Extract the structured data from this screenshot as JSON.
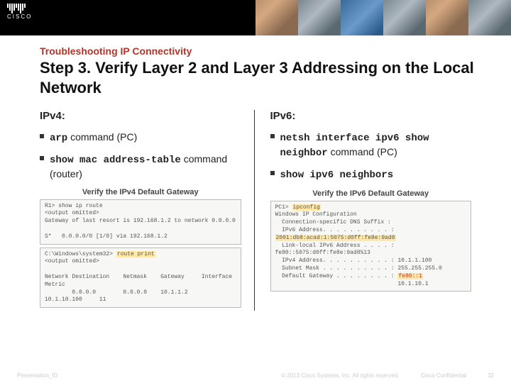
{
  "logo_text": "CISCO",
  "breadcrumb": "Troubleshooting IP Connectivity",
  "title": "Step 3. Verify Layer 2 and Layer 3 Addressing on the Local Network",
  "left": {
    "heading": "IPv4:",
    "b1_cmd": "arp",
    "b1_rest": " command (PC)",
    "b2_cmd": "show mac address-table",
    "b2_rest": " command (router)",
    "shot_title": "Verify the IPv4 Default Gateway",
    "pane1": "R1> show ip route\n<output omitted>\nGateway of last resort is 192.168.1.2 to network 0.0.0.0\n\nS*   0.0.0.0/0 [1/0] via 192.168.1.2",
    "pane2_pre": "C:\\Windows\\system32> ",
    "pane2_cmd": "route print",
    "pane2_rest": "\n<output omitted>\n\nNetwork Destination    Netmask    Gateway     Interface    Metric\n        0.0.0.0        0.0.0.0    10.1.1.2    10.1.10.100     11"
  },
  "right": {
    "heading": "IPv6:",
    "b1_cmd": "netsh interface ipv6 show neighbor",
    "b1_rest": " command (PC)",
    "b2_cmd": "show ipv6 neighbors",
    "shot_title": "Verify the IPv6 Default Gateway",
    "pane_pre": "PC1> ",
    "pane_cmd": "ipconfig",
    "pane_l1": "Windows IP Configuration",
    "pane_l2": "  Connection-specific DNS Suffix :",
    "pane_l3": "  IPv6 Address. . . . . . . . . . :",
    "pane_hl": "2001:db8:acad:1:5075:d0ff:fe8e:9ad8",
    "pane_l4_a": "  Link-local IPv6 Address . . . . : fe80::5075:d0ff:fe8e:9a",
    "pane_l4_b": "d8%13",
    "pane_l5": "  IPv4 Address. . . . . . . . . . : 10.1.1.100",
    "pane_l6": "  Subnet Mask . . . . . . . . . . : 255.255.255.0",
    "pane_l7a": "  Default Gateway . . . . . . . . : ",
    "pane_l7b": "fe80::1",
    "pane_l8": "                                    10.1.10.1"
  },
  "footer": {
    "left": "Presentation_ID",
    "copyright": "© 2013 Cisco Systems, Inc. All rights reserved.",
    "conf": "Cisco Confidential",
    "page": "32"
  }
}
